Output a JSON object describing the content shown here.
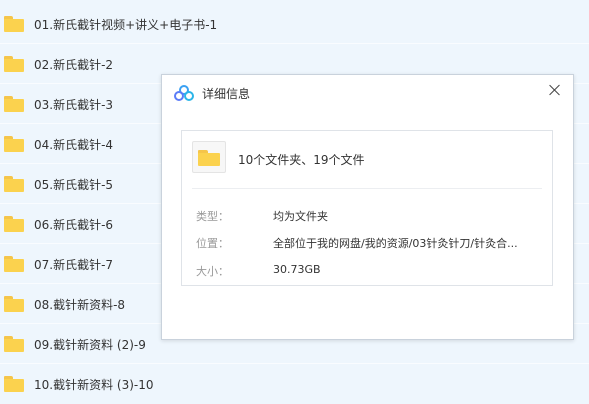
{
  "file_list": {
    "items": [
      {
        "name": "01.新氏截针视频+讲义+电子书-1"
      },
      {
        "name": "02.新氏截针-2"
      },
      {
        "name": "03.新氏截针-3"
      },
      {
        "name": "04.新氏截针-4"
      },
      {
        "name": "05.新氏截针-5"
      },
      {
        "name": "06.新氏截针-6"
      },
      {
        "name": "07.新氏截针-7"
      },
      {
        "name": "08.截针新资料-8"
      },
      {
        "name": "09.截针新资料 (2)-9"
      },
      {
        "name": "10.截针新资料 (3)-10"
      }
    ]
  },
  "dialog": {
    "title": "详细信息",
    "summary": "10个文件夹、19个文件",
    "fields": [
      {
        "label": "类型：",
        "value": "均为文件夹"
      },
      {
        "label": "位置：",
        "value": "全部位于我的网盘/我的资源/03针灸针刀/针灸合..."
      },
      {
        "label": "大小：",
        "value": "30.73GB"
      }
    ]
  },
  "colors": {
    "list_background": "#eef6fd",
    "folder_yellow": "#fbd24e",
    "dialog_border": "#c9d2dc"
  },
  "icons": {
    "folder": "folder-icon",
    "app": "cloud-logo-icon",
    "close": "close-icon"
  }
}
